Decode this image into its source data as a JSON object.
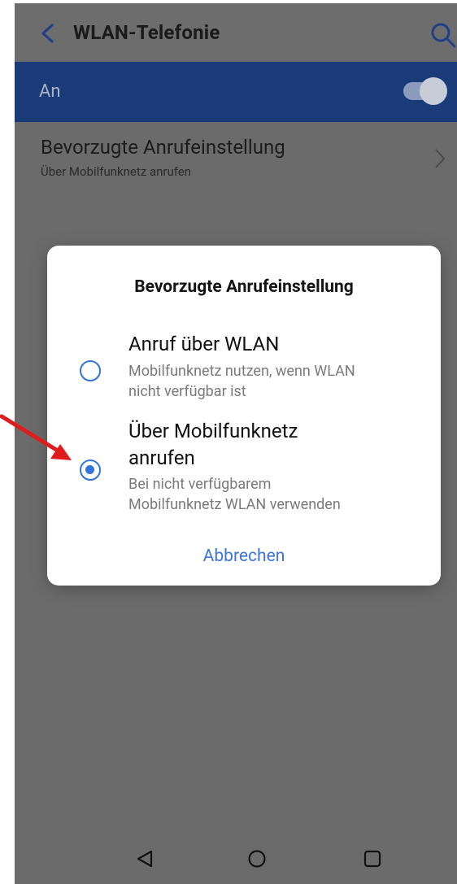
{
  "appbar": {
    "title": "WLAN-Telefonie",
    "back_icon": "chevron-left-icon",
    "search_icon": "search-icon"
  },
  "master_switch": {
    "label": "An",
    "state": "on"
  },
  "preference": {
    "title": "Bevorzugte Anrufeinstellung",
    "summary": "Über Mobilfunknetz anrufen"
  },
  "dialog": {
    "title": "Bevorzugte Anrufeinstellung",
    "options": [
      {
        "title": "Anruf über WLAN",
        "desc_line1": "Mobilfunknetz nutzen, wenn WLAN",
        "desc_line2": "nicht verfügbar ist",
        "selected": false
      },
      {
        "title_line1": "Über Mobilfunknetz",
        "title_line2": "anrufen",
        "desc_line1": "Bei nicht verfügbarem",
        "desc_line2": "Mobilfunknetz WLAN verwenden",
        "selected": true
      }
    ],
    "cancel_label": "Abbrechen"
  },
  "navbar": {
    "icons": [
      "nav-back-icon",
      "nav-home-icon",
      "nav-recents-icon"
    ]
  },
  "colors": {
    "accent": "#3273dc",
    "scrim": "#6b6b6b",
    "master_bar": "#1a3a78",
    "annotation": "#e01b1b"
  }
}
